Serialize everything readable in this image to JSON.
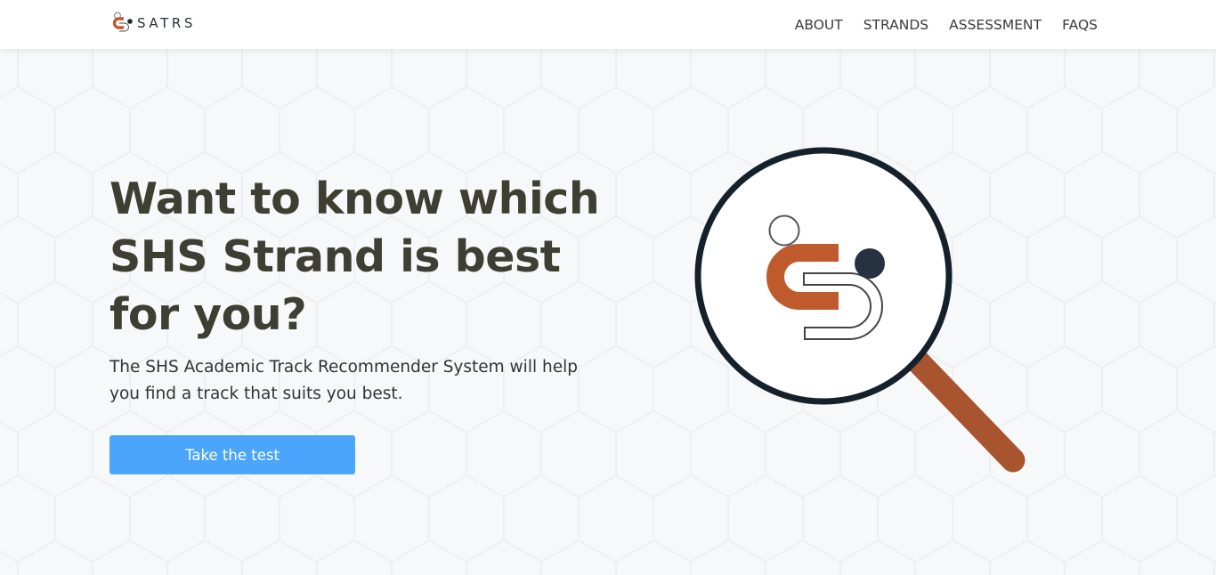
{
  "brand": {
    "name": "SATRS",
    "logo_icon": "satrs-logo-icon"
  },
  "nav": {
    "items": [
      {
        "label": "ABOUT"
      },
      {
        "label": "STRANDS"
      },
      {
        "label": "ASSESSMENT"
      },
      {
        "label": "FAQS"
      }
    ]
  },
  "hero": {
    "headline": "Want to know which SHS Strand is best for you?",
    "subtext": "The SHS Academic Track Recommender System will help you find a track that suits you best.",
    "cta_label": "Take the test"
  },
  "illustration": {
    "icon": "magnifying-glass-logo-icon"
  },
  "colors": {
    "accent_blue": "#4aa5fb",
    "brand_orange": "#bf5a2d",
    "dark_navy": "#1a2430",
    "headline": "#3e3e32",
    "background": "#f7f8fa"
  }
}
